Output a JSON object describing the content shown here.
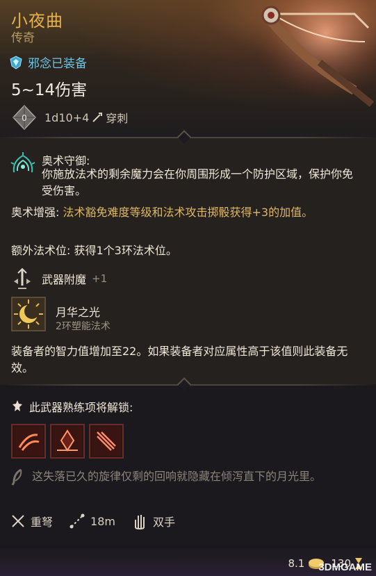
{
  "item": {
    "name": "小夜曲",
    "rarity": "传奇",
    "equip_status": "邪念已装备",
    "damage": "5~14伤害",
    "dice": "1d10+4",
    "damage_type": "穿刺"
  },
  "effects": {
    "ward_title": "奥术守御:",
    "ward_desc": "你施放法术的剩余魔力会在你周围形成一个防护区域，保护你免受伤害。",
    "arcane_label": "奥术增强:",
    "arcane_text": "法术豁免难度等级和法术攻击掷骰获得+3的加值。",
    "slot_label": "额外法术位:",
    "slot_text": "获得1个3环法术位。",
    "enchant_label": "武器附魔",
    "enchant_value": "+1",
    "spell_name": "月华之光",
    "spell_type": "2环塑能法术",
    "int_text": "装备者的智力值增加至22。如果装备者对应属性高于该值则此装备无效。"
  },
  "proficiency": {
    "label": "此武器熟练项将解锁:"
  },
  "lore": "这失落已久的旋律仅剩的回响就隐藏在倾泻直下的月光里。",
  "stats": {
    "weapon_type": "重弩",
    "range": "18m",
    "handedness": "双手"
  },
  "footer": {
    "weight": "8.1",
    "value": "130"
  },
  "watermark": "3DMGAME",
  "colors": {
    "legendary": "#e6b04a",
    "equip_blue": "#6ec6e6",
    "highlight_gold": "#e0b864",
    "lore_grey": "#8c8479"
  },
  "icons": [
    "shield-icon",
    "dice-icon",
    "pierce-icon",
    "arcane-ward-icon",
    "enchant-icon",
    "moonbeam-spell-icon",
    "proficiency-icon",
    "crossbow-icon",
    "range-icon",
    "hand-icon",
    "feather-icon",
    "coin-icon",
    "hourglass-icon"
  ]
}
